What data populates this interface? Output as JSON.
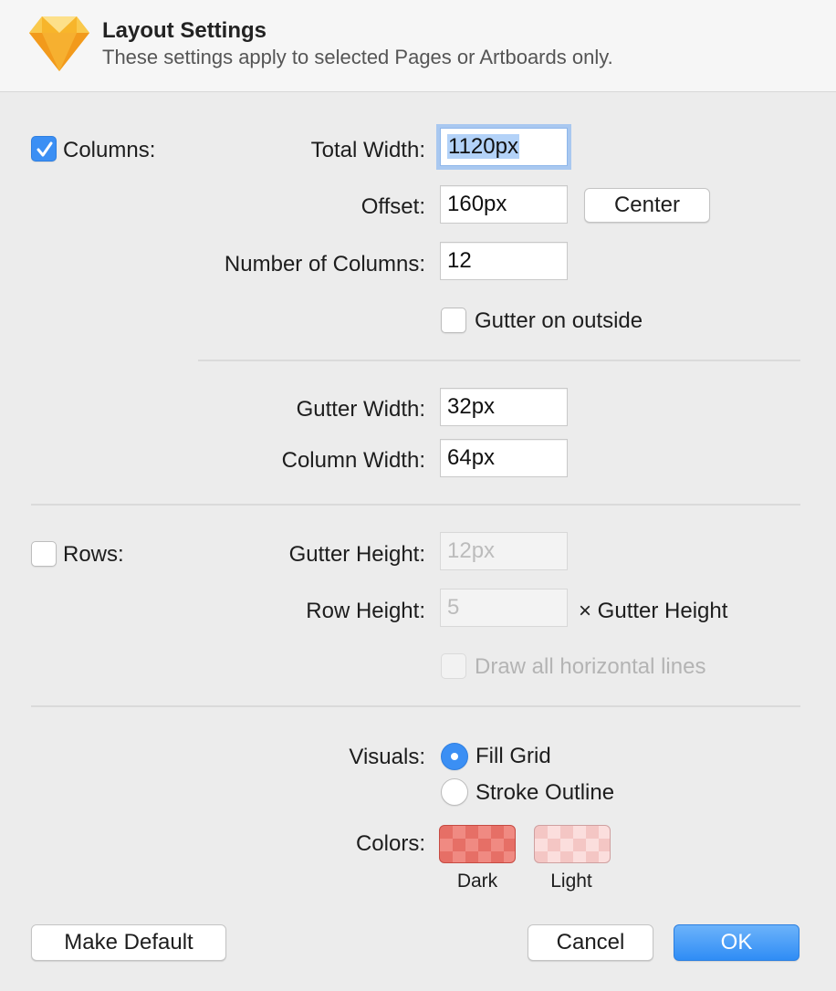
{
  "header": {
    "title": "Layout Settings",
    "subtitle": "These settings apply to selected Pages or Artboards only.",
    "logo_icon": "sketch-diamond-icon"
  },
  "columns": {
    "enabled": true,
    "checkbox_label": "Columns:",
    "total_width_label": "Total Width:",
    "total_width_value": "1120px",
    "offset_label": "Offset:",
    "offset_value": "160px",
    "center_button": "Center",
    "number_label": "Number of Columns:",
    "number_value": "12",
    "gutter_outside_label": "Gutter on outside",
    "gutter_outside_checked": false,
    "gutter_width_label": "Gutter Width:",
    "gutter_width_value": "32px",
    "column_width_label": "Column Width:",
    "column_width_value": "64px"
  },
  "rows": {
    "enabled": false,
    "checkbox_label": "Rows:",
    "gutter_height_label": "Gutter Height:",
    "gutter_height_placeholder": "12px",
    "row_height_label": "Row Height:",
    "row_height_placeholder": "5",
    "row_height_suffix": "× Gutter Height",
    "draw_lines_label": "Draw all horizontal lines",
    "draw_lines_checked": false
  },
  "visuals": {
    "label": "Visuals:",
    "options": [
      "Fill Grid",
      "Stroke Outline"
    ],
    "selected": "Fill Grid"
  },
  "colors": {
    "label": "Colors:",
    "dark_label": "Dark",
    "light_label": "Light",
    "dark_color": "#e66f66",
    "light_color": "#f4c6c4"
  },
  "footer": {
    "make_default": "Make Default",
    "cancel": "Cancel",
    "ok": "OK"
  },
  "accent_color": "#3b8ff4"
}
